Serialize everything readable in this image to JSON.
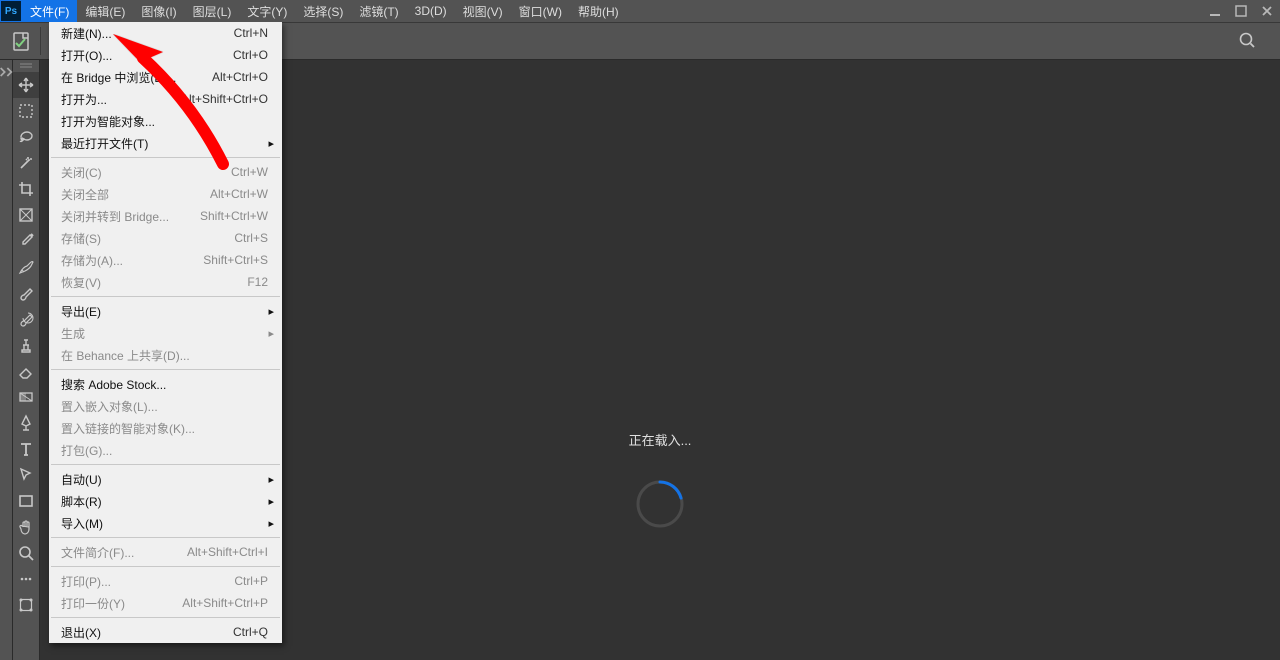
{
  "app_badge": "Ps",
  "menubar": [
    "文件(F)",
    "编辑(E)",
    "图像(I)",
    "图层(L)",
    "文字(Y)",
    "选择(S)",
    "滤镜(T)",
    "3D(D)",
    "视图(V)",
    "窗口(W)",
    "帮助(H)"
  ],
  "active_menu_index": 0,
  "loading_label": "正在载入...",
  "file_menu": [
    {
      "label": "新建(N)...",
      "shortcut": "Ctrl+N"
    },
    {
      "label": "打开(O)...",
      "shortcut": "Ctrl+O"
    },
    {
      "label": "在 Bridge 中浏览(B)...",
      "shortcut": "Alt+Ctrl+O"
    },
    {
      "label": "打开为...",
      "shortcut": "Alt+Shift+Ctrl+O"
    },
    {
      "label": "打开为智能对象..."
    },
    {
      "label": "最近打开文件(T)",
      "submenu": true
    },
    {
      "sep": true
    },
    {
      "label": "关闭(C)",
      "shortcut": "Ctrl+W",
      "disabled": true
    },
    {
      "label": "关闭全部",
      "shortcut": "Alt+Ctrl+W",
      "disabled": true
    },
    {
      "label": "关闭并转到 Bridge...",
      "shortcut": "Shift+Ctrl+W",
      "disabled": true
    },
    {
      "label": "存储(S)",
      "shortcut": "Ctrl+S",
      "disabled": true
    },
    {
      "label": "存储为(A)...",
      "shortcut": "Shift+Ctrl+S",
      "disabled": true
    },
    {
      "label": "恢复(V)",
      "shortcut": "F12",
      "disabled": true
    },
    {
      "sep": true
    },
    {
      "label": "导出(E)",
      "submenu": true
    },
    {
      "label": "生成",
      "submenu": true,
      "disabled": true
    },
    {
      "label": "在 Behance 上共享(D)...",
      "disabled": true
    },
    {
      "sep": true
    },
    {
      "label": "搜索 Adobe Stock..."
    },
    {
      "label": "置入嵌入对象(L)...",
      "disabled": true
    },
    {
      "label": "置入链接的智能对象(K)...",
      "disabled": true
    },
    {
      "label": "打包(G)...",
      "disabled": true
    },
    {
      "sep": true
    },
    {
      "label": "自动(U)",
      "submenu": true
    },
    {
      "label": "脚本(R)",
      "submenu": true
    },
    {
      "label": "导入(M)",
      "submenu": true
    },
    {
      "sep": true
    },
    {
      "label": "文件简介(F)...",
      "shortcut": "Alt+Shift+Ctrl+I",
      "disabled": true
    },
    {
      "sep": true
    },
    {
      "label": "打印(P)...",
      "shortcut": "Ctrl+P",
      "disabled": true
    },
    {
      "label": "打印一份(Y)",
      "shortcut": "Alt+Shift+Ctrl+P",
      "disabled": true
    },
    {
      "sep": true
    },
    {
      "label": "退出(X)",
      "shortcut": "Ctrl+Q"
    }
  ],
  "tools": [
    {
      "name": "move-tool",
      "selected": true
    },
    {
      "name": "rectangular-marquee-tool"
    },
    {
      "name": "lasso-tool"
    },
    {
      "name": "magic-wand-tool"
    },
    {
      "name": "crop-tool"
    },
    {
      "name": "frame-tool"
    },
    {
      "name": "eyedropper-tool"
    },
    {
      "name": "spot-healing-tool"
    },
    {
      "name": "brush-tool"
    },
    {
      "name": "history-brush-tool"
    },
    {
      "name": "clone-stamp-tool"
    },
    {
      "name": "eraser-tool"
    },
    {
      "name": "gradient-tool"
    },
    {
      "name": "pen-tool"
    },
    {
      "name": "type-tool"
    },
    {
      "name": "path-selection-tool"
    },
    {
      "name": "rectangle-shape-tool"
    },
    {
      "name": "hand-tool"
    },
    {
      "name": "zoom-tool"
    },
    {
      "name": "edit-toolbar"
    },
    {
      "name": "3d-tool"
    }
  ]
}
